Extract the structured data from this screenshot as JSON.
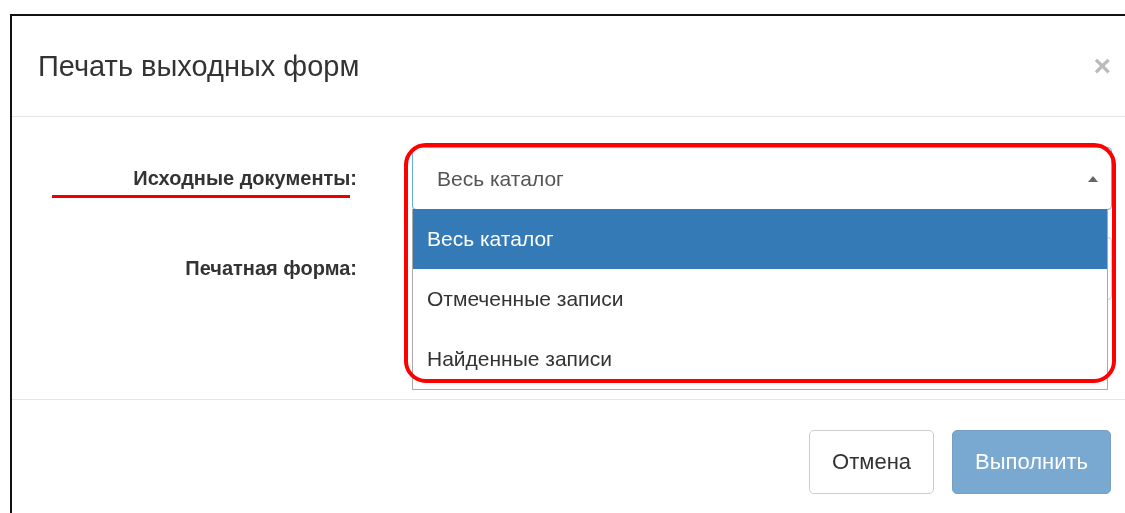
{
  "dialog": {
    "title": "Печать выходных форм",
    "close": "×"
  },
  "fields": [
    {
      "label": "Исходные документы:",
      "value": "Весь каталог",
      "expanded": true,
      "options": [
        {
          "label": "Весь каталог",
          "selected": true
        },
        {
          "label": "Отмеченные записи",
          "selected": false
        },
        {
          "label": "Найденные записи",
          "selected": false
        }
      ]
    },
    {
      "label": "Печатная форма:",
      "expanded": false
    }
  ],
  "buttons": [
    {
      "label": "Отмена",
      "kind": "default",
      "disabled": false
    },
    {
      "label": "Выполнить",
      "kind": "primary",
      "disabled": true
    }
  ]
}
